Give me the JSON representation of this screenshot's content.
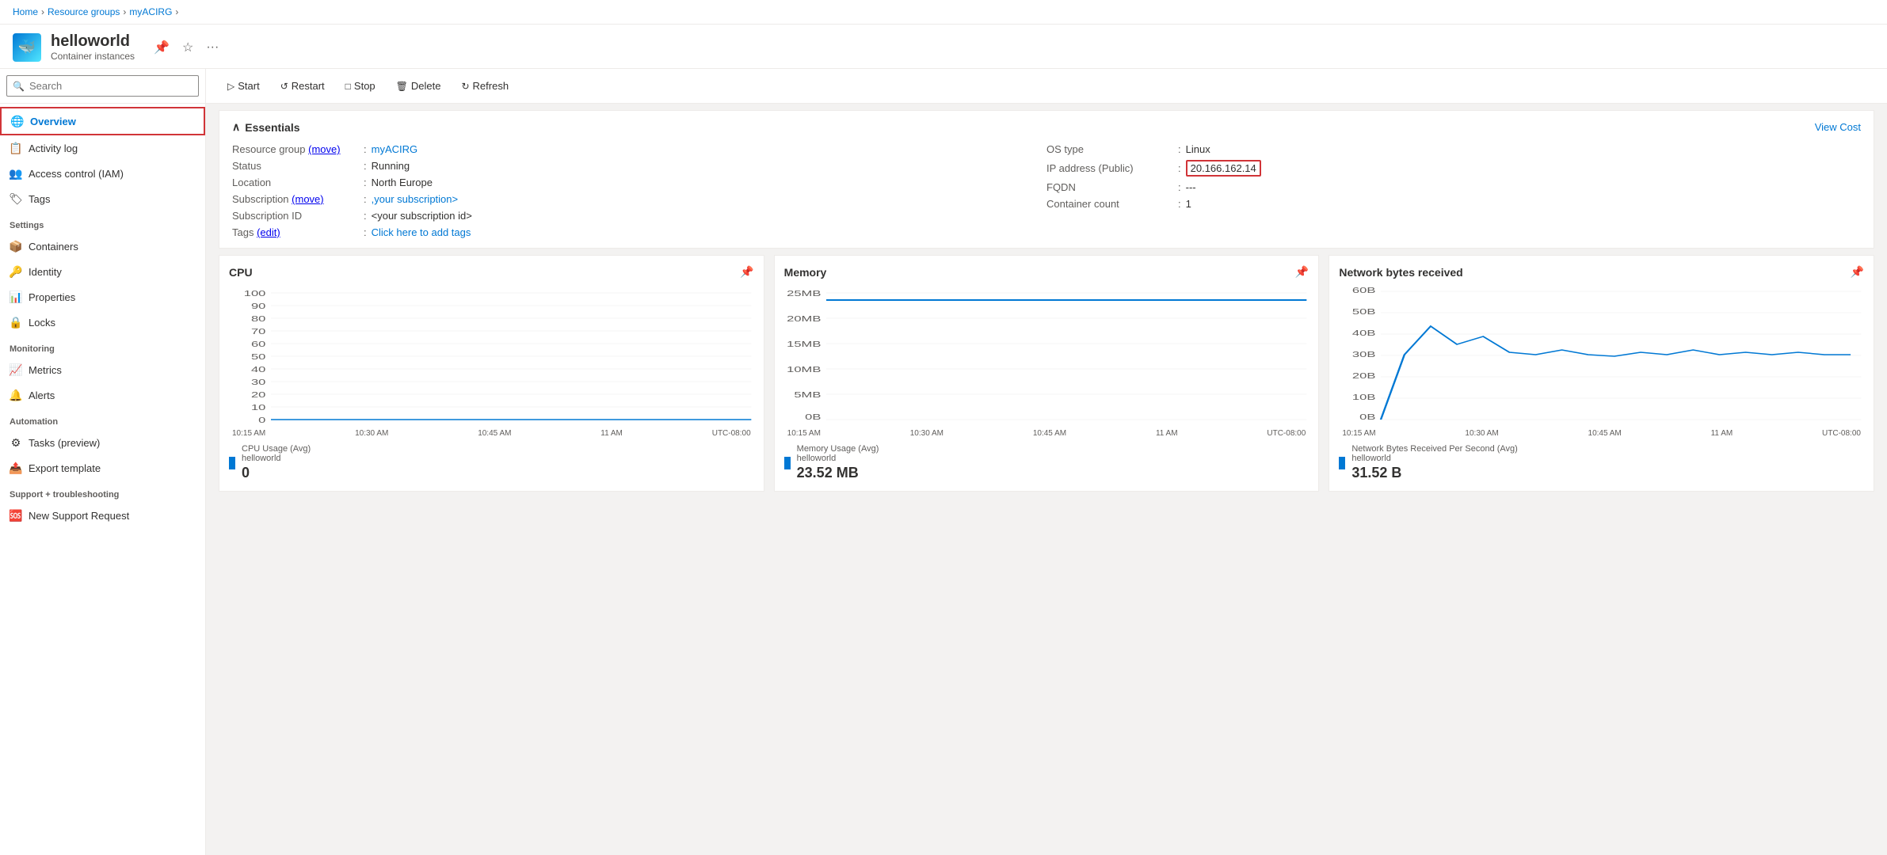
{
  "breadcrumb": {
    "items": [
      "Home",
      "Resource groups",
      "myACIRG"
    ],
    "separators": [
      ">",
      ">",
      ">"
    ]
  },
  "resource": {
    "name": "helloworld",
    "subtitle": "Container instances",
    "icon": "🐳"
  },
  "toolbar": {
    "start_label": "Start",
    "restart_label": "Restart",
    "stop_label": "Stop",
    "delete_label": "Delete",
    "refresh_label": "Refresh"
  },
  "sidebar": {
    "search_placeholder": "Search",
    "nav_items": [
      {
        "id": "overview",
        "label": "Overview",
        "icon": "🌐",
        "active": true
      },
      {
        "id": "activity-log",
        "label": "Activity log",
        "icon": "📋"
      },
      {
        "id": "access-control",
        "label": "Access control (IAM)",
        "icon": "👥"
      },
      {
        "id": "tags",
        "label": "Tags",
        "icon": "🏷"
      }
    ],
    "sections": [
      {
        "label": "Settings",
        "items": [
          {
            "id": "containers",
            "label": "Containers",
            "icon": "📦"
          },
          {
            "id": "identity",
            "label": "Identity",
            "icon": "🔑"
          },
          {
            "id": "properties",
            "label": "Properties",
            "icon": "📊"
          },
          {
            "id": "locks",
            "label": "Locks",
            "icon": "🔒"
          }
        ]
      },
      {
        "label": "Monitoring",
        "items": [
          {
            "id": "metrics",
            "label": "Metrics",
            "icon": "📈"
          },
          {
            "id": "alerts",
            "label": "Alerts",
            "icon": "🔔"
          }
        ]
      },
      {
        "label": "Automation",
        "items": [
          {
            "id": "tasks",
            "label": "Tasks (preview)",
            "icon": "⚙"
          },
          {
            "id": "export-template",
            "label": "Export template",
            "icon": "📤"
          }
        ]
      },
      {
        "label": "Support + troubleshooting",
        "items": [
          {
            "id": "new-support",
            "label": "New Support Request",
            "icon": "🆘"
          }
        ]
      }
    ]
  },
  "essentials": {
    "title": "Essentials",
    "view_cost_label": "View Cost",
    "left_fields": [
      {
        "label": "Resource group",
        "extra": "(move)",
        "value": "myACIRG",
        "link": true
      },
      {
        "label": "Status",
        "value": "Running"
      },
      {
        "label": "Location",
        "value": "North Europe"
      },
      {
        "label": "Subscription",
        "extra": "(move)",
        "value": ",your subscription>",
        "link": true
      },
      {
        "label": "Subscription ID",
        "value": "<your subscription id>"
      },
      {
        "label": "Tags",
        "extra": "(edit)",
        "value": "Click here to add tags",
        "link": true
      }
    ],
    "right_fields": [
      {
        "label": "OS type",
        "value": "Linux"
      },
      {
        "label": "IP address (Public)",
        "value": "20.166.162.14",
        "highlight": true
      },
      {
        "label": "FQDN",
        "value": "---"
      },
      {
        "label": "Container count",
        "value": "1"
      }
    ]
  },
  "charts": {
    "cpu": {
      "title": "CPU",
      "legend_label": "CPU Usage (Avg)",
      "legend_sub": "helloworld",
      "value": "0",
      "y_labels": [
        "100",
        "90",
        "80",
        "70",
        "60",
        "50",
        "40",
        "30",
        "20",
        "10",
        "0"
      ],
      "x_labels": [
        "10:15 AM",
        "10:30 AM",
        "10:45 AM",
        "11 AM",
        "UTC-08:00"
      ]
    },
    "memory": {
      "title": "Memory",
      "legend_label": "Memory Usage (Avg)",
      "legend_sub": "helloworld",
      "value": "23.52 MB",
      "y_labels": [
        "25MB",
        "20MB",
        "15MB",
        "10MB",
        "5MB",
        "0B"
      ],
      "x_labels": [
        "10:15 AM",
        "10:30 AM",
        "10:45 AM",
        "11 AM",
        "UTC-08:00"
      ]
    },
    "network": {
      "title": "Network bytes received",
      "legend_label": "Network Bytes Received Per Second (Avg)",
      "legend_sub": "helloworld",
      "value": "31.52 B",
      "y_labels": [
        "60B",
        "50B",
        "40B",
        "30B",
        "20B",
        "10B",
        "0B"
      ],
      "x_labels": [
        "10:15 AM",
        "10:30 AM",
        "10:45 AM",
        "11 AM",
        "UTC-08:00"
      ]
    }
  }
}
